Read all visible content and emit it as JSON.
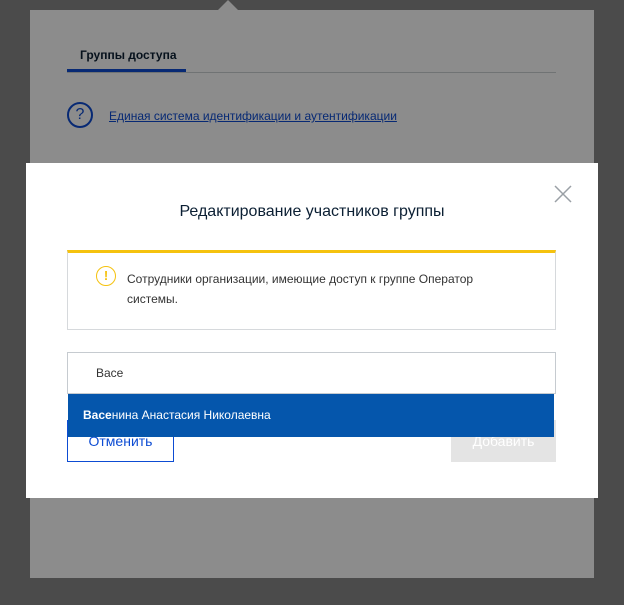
{
  "background": {
    "tab_label": "Группы доступа",
    "help_icon_glyph": "?",
    "link_text": "Единая система идентификации и аутентификации"
  },
  "modal": {
    "title": "Редактирование участников группы",
    "close_icon": "close-icon",
    "notice": {
      "icon_glyph": "!",
      "text": "Сотрудники организации, имеющие доступ к группе Оператор системы."
    },
    "search": {
      "value": "Васе",
      "placeholder": ""
    },
    "suggestion": {
      "match": "Васе",
      "rest": "нина Анастасия Николаевна"
    },
    "cancel_label": "Отменить",
    "add_label": "Добавить"
  },
  "colors": {
    "accent": "#0d4cd3",
    "suggestion_bg": "#0556ac",
    "warning": "#f5c20f",
    "disabled_button": "#e4e4e4"
  }
}
